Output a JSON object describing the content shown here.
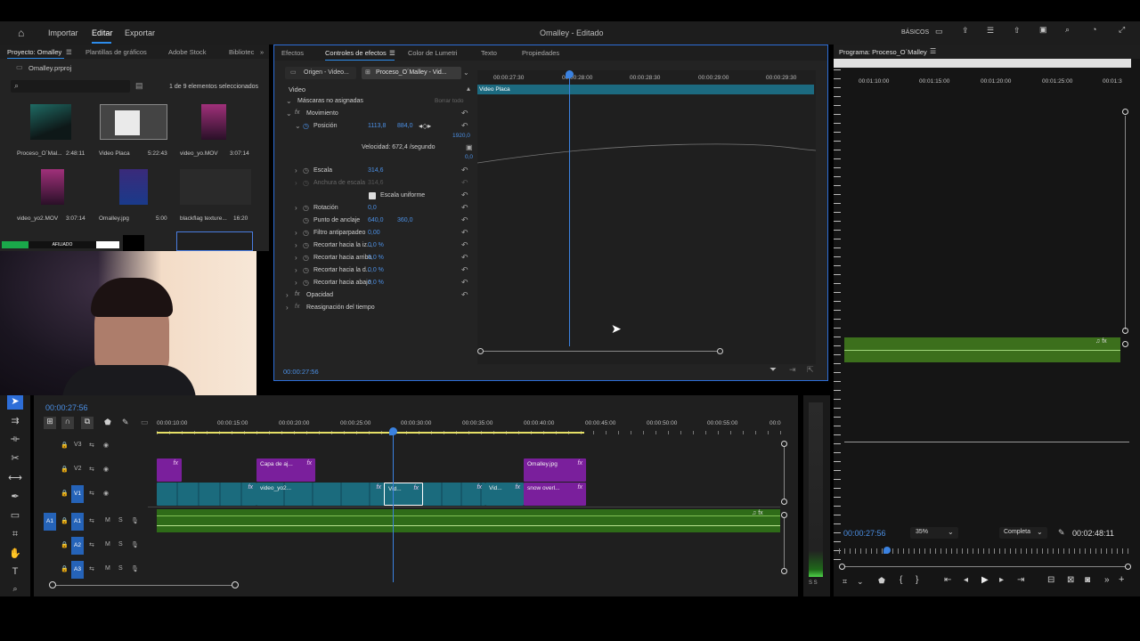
{
  "app": {
    "title": "Omalley - Editado",
    "nav": [
      "Importar",
      "Editar",
      "Exportar"
    ],
    "workspace": "BÁSICOS"
  },
  "project": {
    "tabs": [
      "Proyecto: Omalley",
      "Plantillas de gráficos",
      "Adobe Stock",
      "Bibliotec"
    ],
    "file": "Omalley.prproj",
    "selection_count": "1 de 9 elementos seleccionados",
    "items": [
      {
        "name": "Proceso_O´Mal...",
        "duration": "2:48:11"
      },
      {
        "name": "Video Placa",
        "duration": "5:22:43"
      },
      {
        "name": "video_yo.MOV",
        "duration": "3:07:14"
      },
      {
        "name": "video_yo2.MOV",
        "duration": "3:07:14"
      },
      {
        "name": "Omalley.jpg",
        "duration": "5:00"
      },
      {
        "name": "blackflag texture...",
        "duration": "16:20"
      }
    ],
    "strip_label": "AFILIADO"
  },
  "effects": {
    "tabs": [
      "Efectos",
      "Controles de efectos",
      "Color de Lumetri",
      "Texto",
      "Propiedades"
    ],
    "source_tab": "Origen - Video...",
    "sequence_tab": "Proceso_O´Malley - Vid...",
    "section_label": "Video",
    "clip_label": "Video Placa",
    "ruler": [
      "00:00:27:30",
      "00:00:28:00",
      "00:00:28:30",
      "00:00:29:00",
      "00:00:29:30"
    ],
    "masks_label": "Máscaras no asignadas",
    "clear_all": "Borrar todo",
    "rows": [
      {
        "label": "Movimiento",
        "values": []
      },
      {
        "label": "Posición",
        "values": [
          "1113,8",
          "884,0"
        ]
      },
      {
        "label": "Velocidad: 672,4 /segundo",
        "values": []
      },
      {
        "label": "Escala",
        "values": [
          "314,6"
        ]
      },
      {
        "label": "Anchura de escala",
        "values": [
          "314,6"
        ]
      },
      {
        "label": "Escala uniforme",
        "values": []
      },
      {
        "label": "Rotación",
        "values": [
          "0,0"
        ]
      },
      {
        "label": "Punto de anclaje",
        "values": [
          "640,0",
          "360,0"
        ]
      },
      {
        "label": "Filtro antiparpadeo",
        "values": [
          "0,00"
        ]
      },
      {
        "label": "Recortar hacia la iz...",
        "values": [
          "0,0 %"
        ]
      },
      {
        "label": "Recortar hacia arriba",
        "values": [
          "0,0 %"
        ]
      },
      {
        "label": "Recortar hacia la d...",
        "values": [
          "0,0 %"
        ]
      },
      {
        "label": "Recortar hacia abajo",
        "values": [
          "0,0 %"
        ]
      },
      {
        "label": "Opacidad",
        "values": []
      },
      {
        "label": "Reasignación del tiempo",
        "values": []
      }
    ],
    "graph_max": "1920,0",
    "graph_min": "0,0",
    "timecode": "00:00:27:56"
  },
  "program": {
    "title": "Programa: Proceso_O´Malley",
    "ruler": [
      "00:01:10:00",
      "00:01:15:00",
      "00:01:20:00",
      "00:01:25:00",
      "00:01:3"
    ],
    "timecode": "00:00:27:56",
    "zoom": "35%",
    "quality": "Completa",
    "duration": "00:02:48:11"
  },
  "timeline": {
    "timecode": "00:00:27:56",
    "ruler": [
      "00:00:10:00",
      "00:00:15:00",
      "00:00:20:00",
      "00:00:25:00",
      "00:00:30:00",
      "00:00:35:00",
      "00:00:40:00",
      "00:00:45:00",
      "00:00:50:00",
      "00:00:55:00",
      "00:0"
    ],
    "tracks": [
      "V3",
      "V2",
      "V1",
      "A1",
      "A2",
      "A3"
    ],
    "source_patch": [
      "V1",
      "A1"
    ],
    "mute_label": "M",
    "solo_label": "S",
    "clips": [
      {
        "name": "Capa de aj...",
        "track": "V2"
      },
      {
        "name": "Omalley.jpg",
        "track": "V2"
      },
      {
        "name": "video_yo2...",
        "track": "V1"
      },
      {
        "name": "Vid...",
        "track": "V1"
      },
      {
        "name": "Vid...",
        "track": "V1"
      },
      {
        "name": "snow overl...",
        "track": "V1"
      }
    ],
    "meter_label": "S S"
  },
  "colors": {
    "accent_blue": "#2d8ceb",
    "video_clip": "#1b6b7d",
    "graphic_clip": "#7a1f9c",
    "audio_clip": "#2e6b18"
  }
}
